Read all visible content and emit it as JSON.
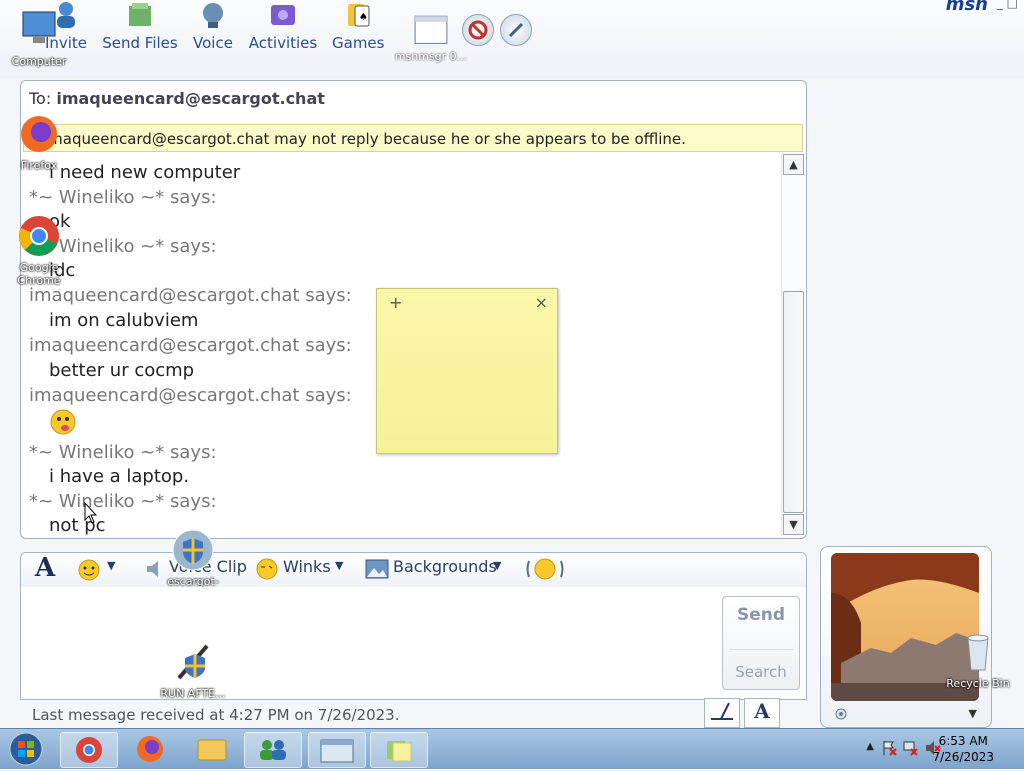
{
  "toolbar": {
    "items": [
      {
        "label": "Invite"
      },
      {
        "label": "Send Files"
      },
      {
        "label": "Voice"
      },
      {
        "label": "Activities"
      },
      {
        "label": "Games"
      }
    ],
    "logo_text": "msn",
    "taskbar_window_label": "msnmsgr 0..."
  },
  "desktop_icons": {
    "computer": "Computer",
    "firefox": "Firefox",
    "chrome": "Google Chrome",
    "escargot": "escargot-wi...",
    "run_after": "RUN AFTE...",
    "recycle": "Recycle Bin"
  },
  "conversation": {
    "to_label": "To:",
    "to_address": "imaqueencard@escargot.chat",
    "offline_notice": "imaqueencard@escargot.chat may not reply because he or she appears to be offline.",
    "messages": [
      {
        "from": "imaqueencard@escargot.chat says:",
        "text": "i need new computer"
      },
      {
        "from": "*~ Wineliko ~* says:",
        "text": "ok"
      },
      {
        "from": "*~ Wineliko ~* says:",
        "text": "idc"
      },
      {
        "from": "imaqueencard@escargot.chat says:",
        "text": "im on calubviem"
      },
      {
        "from": "imaqueencard@escargot.chat says:",
        "text": "better ur cocmp"
      },
      {
        "from": "imaqueencard@escargot.chat says:",
        "text": ""
      },
      {
        "from": "*~ Wineliko ~* says:",
        "text": "i have a laptop."
      },
      {
        "from": "*~ Wineliko ~* says:",
        "text": "not pc"
      }
    ]
  },
  "compose": {
    "voice_clip": "Voice Clip",
    "winks": "Winks",
    "backgrounds": "Backgrounds",
    "send": "Send",
    "search": "Search",
    "status": "Last message received at 4:27 PM on 7/26/2023."
  },
  "sticky_note": {
    "add": "+",
    "close": "×"
  },
  "clock": {
    "time": "6:53 AM",
    "date": "7/26/2023"
  },
  "colors": {
    "accent": "#2b4e8c",
    "offline_bar": "#fbfbc9",
    "taskbar": "#8fb2d6"
  }
}
